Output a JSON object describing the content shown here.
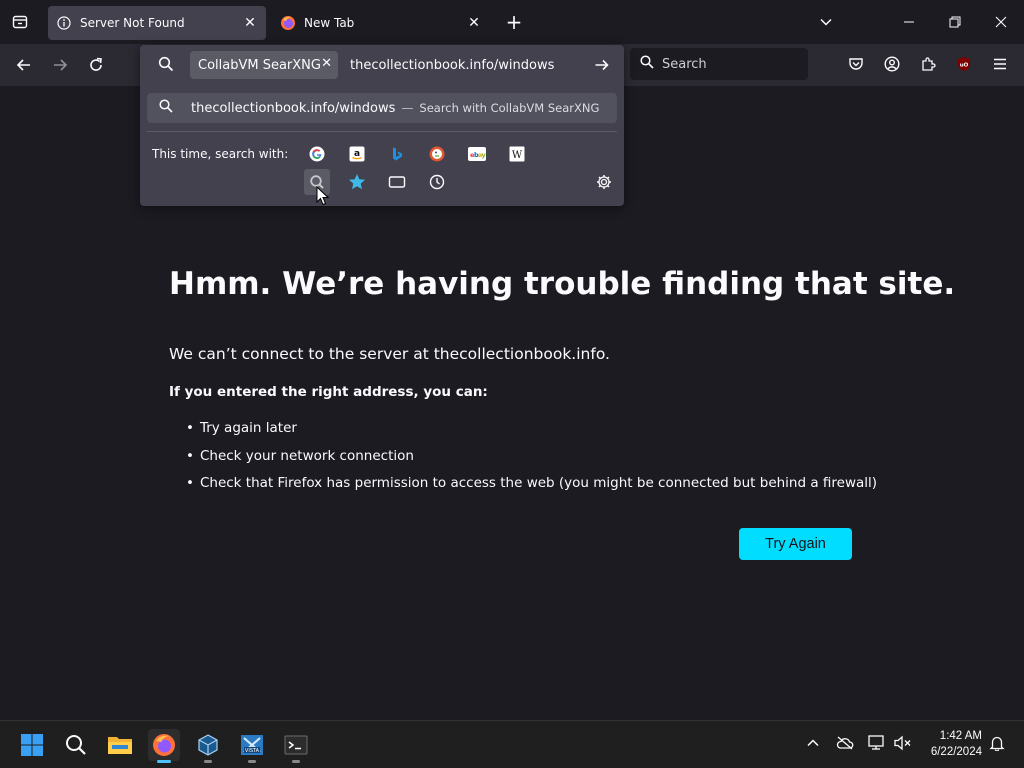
{
  "browser": {
    "tabs": [
      {
        "title": "Server Not Found",
        "icon": "info-icon",
        "active": true
      },
      {
        "title": "New Tab",
        "icon": "firefox-icon",
        "active": false
      }
    ],
    "new_tab_symbol": "+",
    "search_box": {
      "placeholder": "Search"
    }
  },
  "urlbar": {
    "engine_chip": "CollabVM SearXNG",
    "value": "thecollectionbook.info/windows",
    "suggestion": {
      "text": "thecollectionbook.info/windows",
      "separator": "—",
      "action": "Search with CollabVM SearXNG"
    },
    "one_time_label": "This time, search with:",
    "engines": [
      "google-icon",
      "amazon-icon",
      "bing-icon",
      "duckduckgo-icon",
      "ebay-icon",
      "wikipedia-icon",
      "searxng-icon",
      "bookmarks-star-icon",
      "tabs-icon",
      "history-icon"
    ],
    "settings_icon": "gear-icon"
  },
  "error_page": {
    "title": "Hmm. We’re having trouble finding that site.",
    "description": "We can’t connect to the server at thecollectionbook.info.",
    "subheading": "If you entered the right address, you can:",
    "suggestions": [
      "Try again later",
      "Check your network connection",
      "Check that Firefox has permission to access the web (you might be connected but behind a firewall)"
    ],
    "button": "Try Again",
    "accent_color": "#00ddff"
  },
  "taskbar": {
    "apps": [
      "start-icon",
      "search-icon",
      "file-explorer-icon",
      "firefox-icon",
      "virtualbox-icon",
      "vista-app-icon",
      "terminal-icon"
    ],
    "time": "1:42 AM",
    "date": "6/22/2024"
  }
}
